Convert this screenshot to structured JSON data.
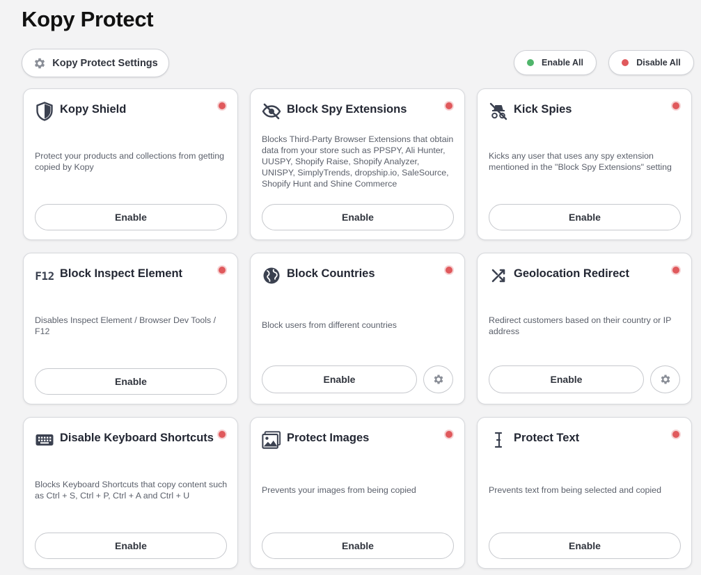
{
  "header": {
    "title": "Kopy Protect",
    "settings_label": "Kopy Protect Settings",
    "enable_all_label": "Enable All",
    "disable_all_label": "Disable All"
  },
  "colors": {
    "enabled_dot": "#4fb56b",
    "disabled_dot": "#e0595c"
  },
  "cards": [
    {
      "title": "Kopy Shield",
      "icon": "shield-icon",
      "status": "disabled",
      "description": "Protect your products and collections from getting copied by Kopy",
      "button": "Enable",
      "has_settings": false
    },
    {
      "title": "Block Spy Extensions",
      "icon": "eye-off-icon",
      "status": "disabled",
      "description": "Blocks Third-Party Browser Extensions that obtain data from your store such as PPSPY, Ali Hunter, UUSPY, Shopify Raise, Shopify Analyzer, UNISPY, SimplyTrends, dropship.io, SaleSource, Shopify Hunt and Shine Commerce",
      "button": "Enable",
      "has_settings": false
    },
    {
      "title": "Kick Spies",
      "icon": "spy-off-icon",
      "status": "disabled",
      "description": "Kicks any user that uses any spy extension mentioned in the \"Block Spy Extensions\" setting",
      "button": "Enable",
      "has_settings": false
    },
    {
      "title": "Block Inspect Element",
      "icon": "f12-icon",
      "icon_text": "F12",
      "status": "disabled",
      "description": "Disables Inspect Element / Browser Dev Tools / F12",
      "button": "Enable",
      "has_settings": false
    },
    {
      "title": "Block Countries",
      "icon": "globe-icon",
      "status": "disabled",
      "description": "Block users from different countries",
      "button": "Enable",
      "has_settings": true
    },
    {
      "title": "Geolocation Redirect",
      "icon": "shuffle-icon",
      "status": "disabled",
      "description": "Redirect customers based on their country or IP address",
      "button": "Enable",
      "has_settings": true
    },
    {
      "title": "Disable Keyboard Shortcuts",
      "icon": "keyboard-icon",
      "status": "disabled",
      "description": "Blocks Keyboard Shortcuts that copy content such as Ctrl + S, Ctrl + P, Ctrl + A and Ctrl + U",
      "button": "Enable",
      "has_settings": false
    },
    {
      "title": "Protect Images",
      "icon": "image-icon",
      "status": "disabled",
      "description": "Prevents your images from being copied",
      "button": "Enable",
      "has_settings": false
    },
    {
      "title": "Protect Text",
      "icon": "text-cursor-icon",
      "status": "disabled",
      "description": "Prevents text from being selected and copied",
      "button": "Enable",
      "has_settings": false
    }
  ]
}
